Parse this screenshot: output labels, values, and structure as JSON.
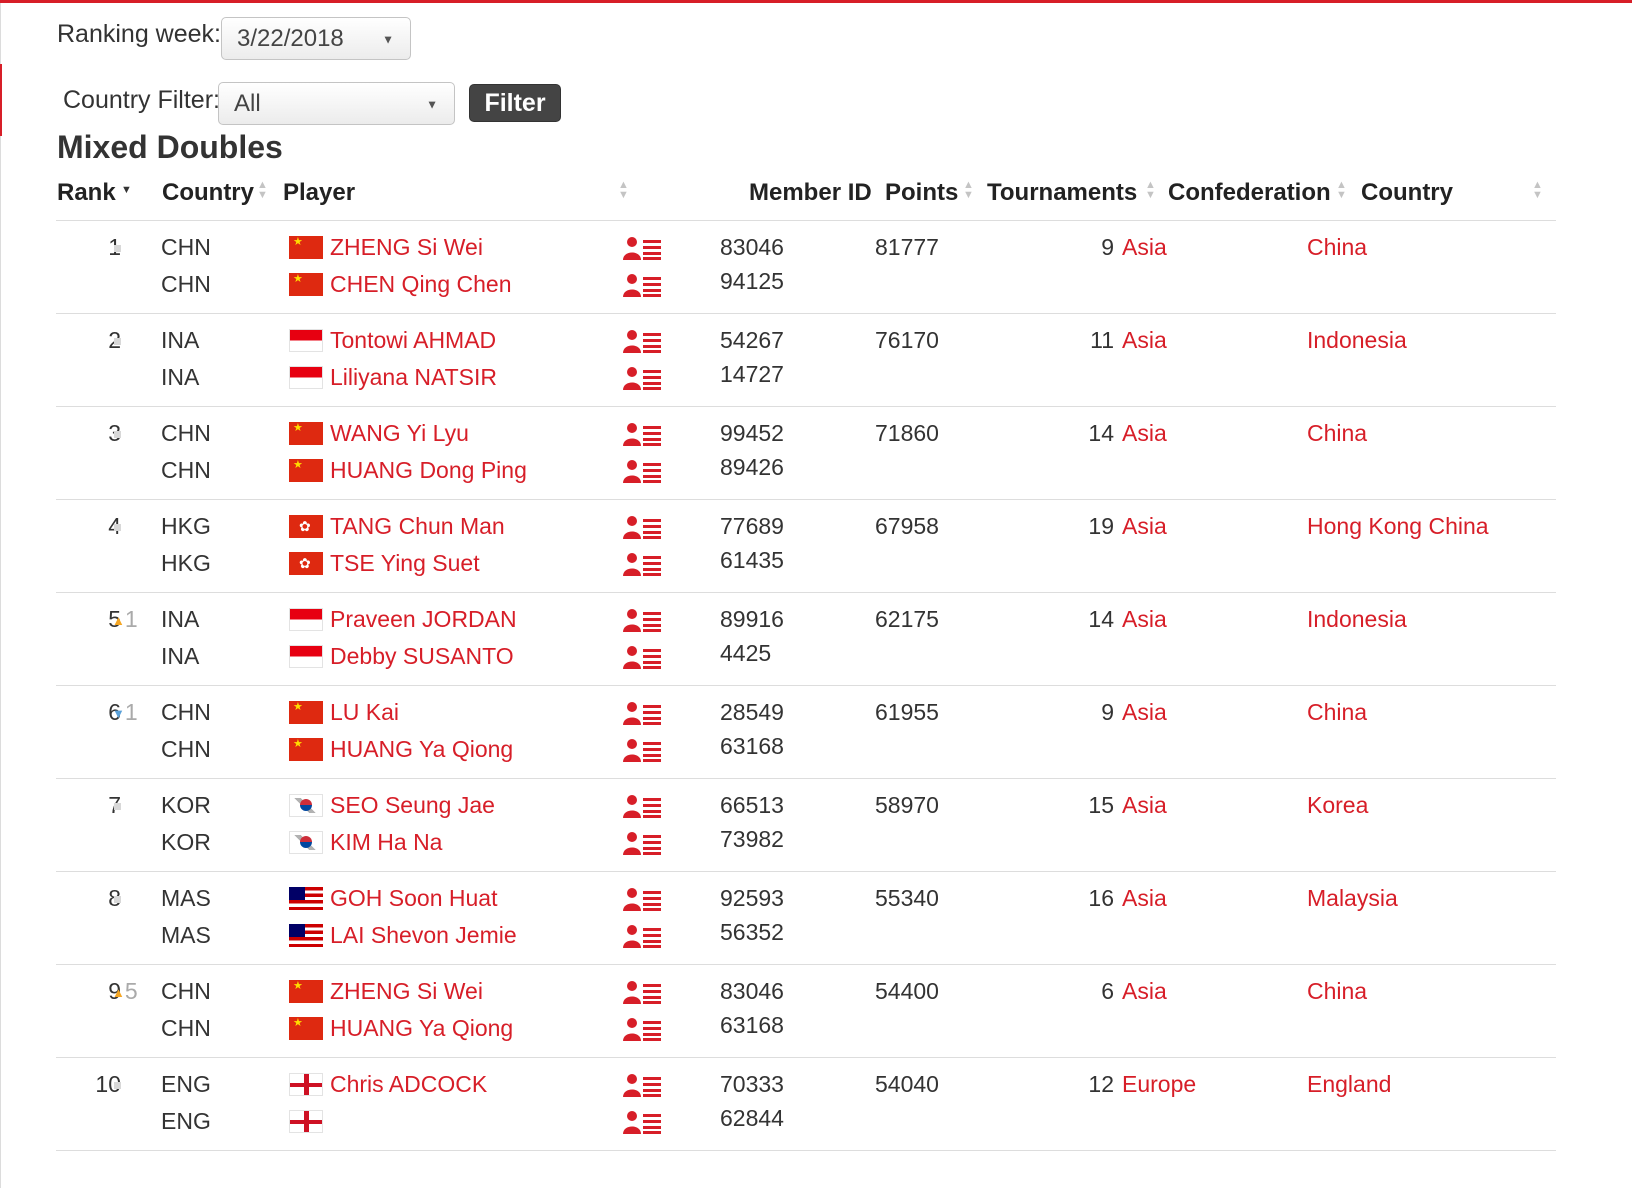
{
  "filters": {
    "ranking_week_label": "Ranking week:",
    "ranking_week_value": "3/22/2018",
    "country_filter_label": "Country Filter:",
    "country_filter_value": "All",
    "filter_button": "Filter"
  },
  "title": "Mixed Doubles",
  "columns": {
    "rank": "Rank",
    "country": "Country",
    "player": "Player",
    "member_id": "Member ID",
    "points": "Points",
    "tournaments": "Tournaments",
    "confederation": "Confederation",
    "country_name": "Country"
  },
  "colors": {
    "accent": "#d71e28",
    "button": "#444444",
    "up": "#f5a623",
    "down": "#5aa0d8"
  },
  "rows": [
    {
      "rank": "1",
      "move": "none",
      "change": "",
      "points": "81777",
      "tournaments": "9",
      "confederation": "Asia",
      "country": "China",
      "players": [
        {
          "code": "CHN",
          "flag": "chn",
          "name": "ZHENG Si Wei",
          "member_id": "83046"
        },
        {
          "code": "CHN",
          "flag": "chn",
          "name": "CHEN Qing Chen",
          "member_id": "94125"
        }
      ]
    },
    {
      "rank": "2",
      "move": "none",
      "change": "",
      "points": "76170",
      "tournaments": "11",
      "confederation": "Asia",
      "country": "Indonesia",
      "players": [
        {
          "code": "INA",
          "flag": "ina",
          "name": "Tontowi AHMAD",
          "member_id": "54267"
        },
        {
          "code": "INA",
          "flag": "ina",
          "name": "Liliyana NATSIR",
          "member_id": "14727"
        }
      ]
    },
    {
      "rank": "3",
      "move": "none",
      "change": "",
      "points": "71860",
      "tournaments": "14",
      "confederation": "Asia",
      "country": "China",
      "players": [
        {
          "code": "CHN",
          "flag": "chn",
          "name": "WANG Yi Lyu",
          "member_id": "99452"
        },
        {
          "code": "CHN",
          "flag": "chn",
          "name": "HUANG Dong Ping",
          "member_id": "89426"
        }
      ]
    },
    {
      "rank": "4",
      "move": "none",
      "change": "",
      "points": "67958",
      "tournaments": "19",
      "confederation": "Asia",
      "country": "Hong Kong China",
      "players": [
        {
          "code": "HKG",
          "flag": "hkg",
          "name": "TANG Chun Man",
          "member_id": "77689"
        },
        {
          "code": "HKG",
          "flag": "hkg",
          "name": "TSE Ying Suet",
          "member_id": "61435"
        }
      ]
    },
    {
      "rank": "5",
      "move": "up",
      "change": "1",
      "points": "62175",
      "tournaments": "14",
      "confederation": "Asia",
      "country": "Indonesia",
      "players": [
        {
          "code": "INA",
          "flag": "ina",
          "name": "Praveen JORDAN",
          "member_id": "89916"
        },
        {
          "code": "INA",
          "flag": "ina",
          "name": "Debby SUSANTO",
          "member_id": "4425"
        }
      ]
    },
    {
      "rank": "6",
      "move": "down",
      "change": "1",
      "points": "61955",
      "tournaments": "9",
      "confederation": "Asia",
      "country": "China",
      "players": [
        {
          "code": "CHN",
          "flag": "chn",
          "name": "LU Kai",
          "member_id": "28549"
        },
        {
          "code": "CHN",
          "flag": "chn",
          "name": "HUANG Ya Qiong",
          "member_id": "63168"
        }
      ]
    },
    {
      "rank": "7",
      "move": "none",
      "change": "",
      "points": "58970",
      "tournaments": "15",
      "confederation": "Asia",
      "country": "Korea",
      "players": [
        {
          "code": "KOR",
          "flag": "kor",
          "name": "SEO Seung Jae",
          "member_id": "66513"
        },
        {
          "code": "KOR",
          "flag": "kor",
          "name": "KIM Ha Na",
          "member_id": "73982"
        }
      ]
    },
    {
      "rank": "8",
      "move": "none",
      "change": "",
      "points": "55340",
      "tournaments": "16",
      "confederation": "Asia",
      "country": "Malaysia",
      "players": [
        {
          "code": "MAS",
          "flag": "mas",
          "name": "GOH Soon Huat",
          "member_id": "92593"
        },
        {
          "code": "MAS",
          "flag": "mas",
          "name": "LAI Shevon Jemie",
          "member_id": "56352"
        }
      ]
    },
    {
      "rank": "9",
      "move": "up",
      "change": "5",
      "points": "54400",
      "tournaments": "6",
      "confederation": "Asia",
      "country": "China",
      "players": [
        {
          "code": "CHN",
          "flag": "chn",
          "name": "ZHENG Si Wei",
          "member_id": "83046"
        },
        {
          "code": "CHN",
          "flag": "chn",
          "name": "HUANG Ya Qiong",
          "member_id": "63168"
        }
      ]
    },
    {
      "rank": "10",
      "move": "none",
      "change": "",
      "points": "54040",
      "tournaments": "12",
      "confederation": "Europe",
      "country": "England",
      "players": [
        {
          "code": "ENG",
          "flag": "eng",
          "name": "Chris ADCOCK",
          "member_id": "70333"
        },
        {
          "code": "ENG",
          "flag": "eng",
          "name": "",
          "member_id": "62844"
        }
      ]
    }
  ]
}
